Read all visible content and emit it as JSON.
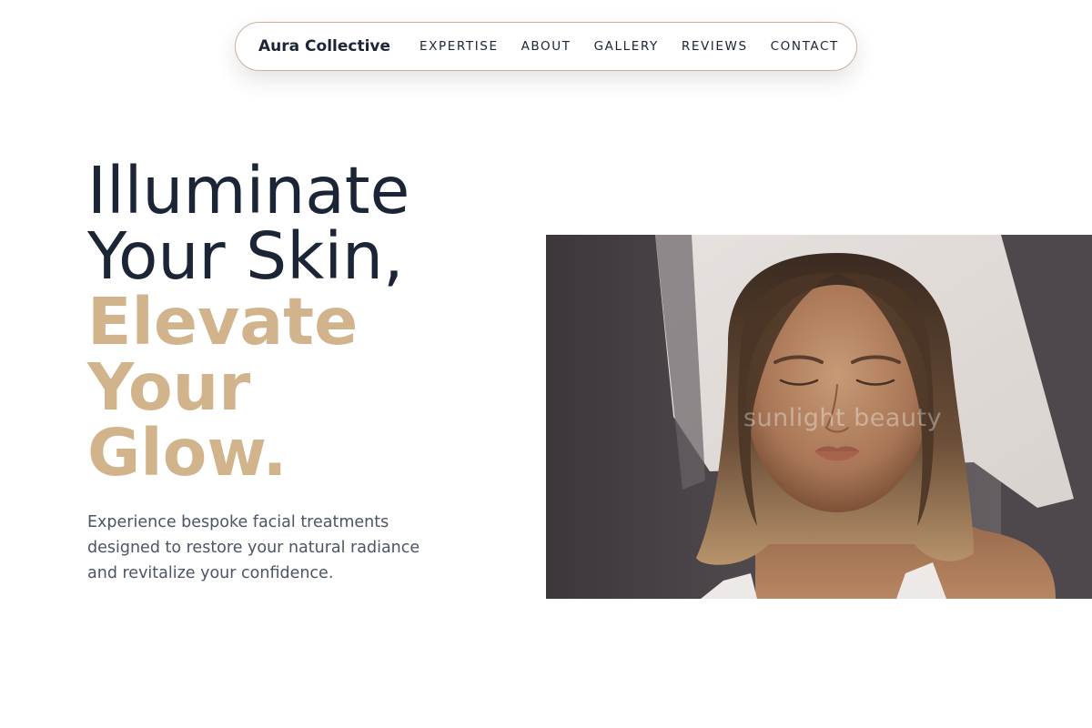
{
  "nav": {
    "brand": "Aura Collective",
    "links": [
      "EXPERTISE",
      "ABOUT",
      "GALLERY",
      "REVIEWS",
      "CONTACT"
    ]
  },
  "hero": {
    "title_line1": "Illuminate",
    "title_line2": "Your Skin,",
    "accent_line1": "Elevate",
    "accent_line2": "Your",
    "accent_line3": "Glow.",
    "description": "Experience bespoke facial treatments designed to restore your natural radiance and revitalize your confidence.",
    "image_caption": "sunlight beauty"
  },
  "colors": {
    "primary_text": "#1b2536",
    "accent": "#d2b48c",
    "body_text": "#4a5565",
    "nav_border": "#c9b29a"
  }
}
